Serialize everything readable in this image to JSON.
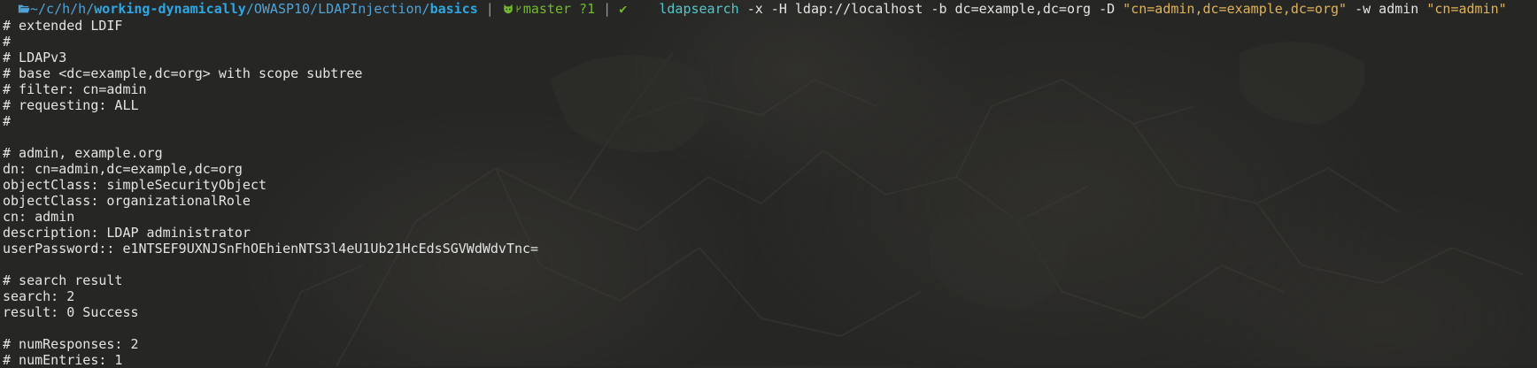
{
  "prompt": {
    "folder_icon": "folder-open-icon",
    "path_prefix": "~/c/h/h/",
    "path_repo": "working-dynamically",
    "path_mid": "/OWASP10/LDAPInjection/",
    "path_dir": "basics",
    "git_icon": "github-cat-icon",
    "branch_icon": "git-branch-icon",
    "branch": "master ?1",
    "status_icon": "check-icon",
    "status": "✔",
    "separator": "|",
    "command": {
      "program": "ldapsearch",
      "args_1": " -x -H ldap://localhost -b dc=example,dc=org -D ",
      "bind_dn": "\"cn=admin,dc=example,dc=org\"",
      "args_2": " -w admin ",
      "filter": "\"cn=admin\""
    }
  },
  "output_lines": [
    "# extended LDIF",
    "#",
    "# LDAPv3",
    "# base <dc=example,dc=org> with scope subtree",
    "# filter: cn=admin",
    "# requesting: ALL",
    "#",
    "",
    "# admin, example.org",
    "dn: cn=admin,dc=example,dc=org",
    "objectClass: simpleSecurityObject",
    "objectClass: organizationalRole",
    "cn: admin",
    "description: LDAP administrator",
    "userPassword:: e1NTSEF9UXNJSnFhOEhienNTS3l4eU1Ub21HcEdsSGVWdWdvTnc=",
    "",
    "# search result",
    "search: 2",
    "result: 0 Success",
    "",
    "# numResponses: 2",
    "# numEntries: 1"
  ],
  "colors": {
    "background": "#262624",
    "text": "#e4e4e2",
    "path": "#4fa3d9",
    "git": "#72b82f",
    "command": "#55c5c9",
    "string": "#e0b35a"
  }
}
